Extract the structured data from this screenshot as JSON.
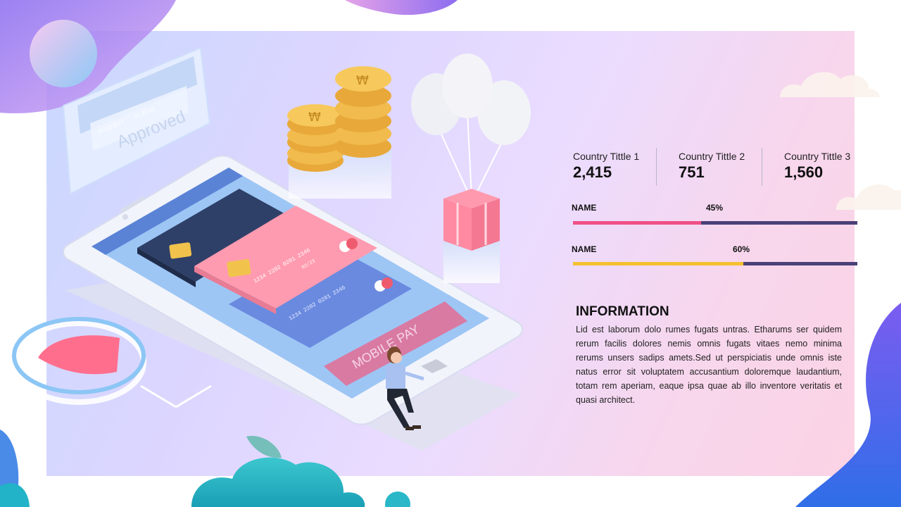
{
  "illustration": {
    "approved_label": "Approved",
    "approved_date": "25/12/2017",
    "approved_time": "01:40:21",
    "card_numbers": [
      "1234",
      "2202",
      "0201",
      "2346"
    ],
    "card_expiry": "02/23",
    "mobile_pay_label": "MOBILE PAY",
    "coin_symbol": "₩"
  },
  "stats": [
    {
      "label": "Country Tittle 1",
      "value": "2,415"
    },
    {
      "label": "Country Tittle 2",
      "value": "751"
    },
    {
      "label": "Country Tittle 3",
      "value": "1,560"
    }
  ],
  "bars": [
    {
      "name": "NAME",
      "percent_label": "45%",
      "value": 0.45,
      "color": "#ef4f86"
    },
    {
      "name": "NAME",
      "percent_label": "60%",
      "value": 0.6,
      "color": "#f5c030"
    }
  ],
  "info": {
    "title": "INFORMATION",
    "body": "Lid est laborum dolo rumes fugats untras. Etharums ser quidem rerum facilis dolores nemis omnis fugats vitaes nemo minima rerums unsers sadips amets.Sed ut perspiciatis unde omnis iste natus error sit voluptatem accusantium doloremque laudantium, totam rem aperiam, eaque ipsa quae ab illo inventore veritatis et quasi architect."
  },
  "colors": {
    "track": "#4a4178",
    "accent_pink": "#ef4f86",
    "accent_yellow": "#f5c030"
  }
}
